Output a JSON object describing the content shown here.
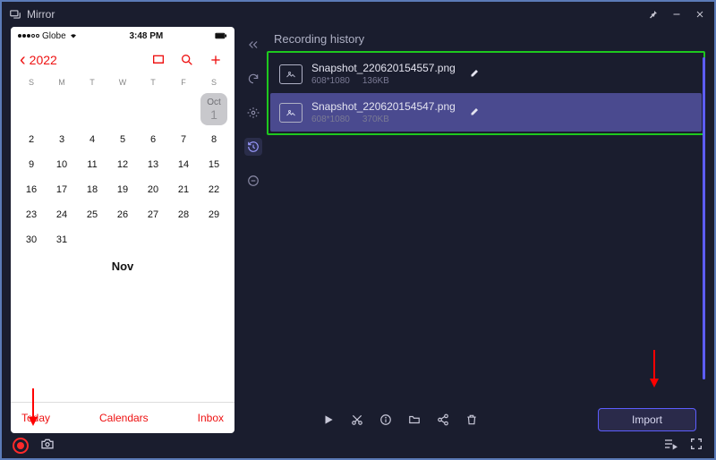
{
  "app": {
    "title": "Mirror"
  },
  "window_controls": [
    "pin",
    "minimize",
    "close"
  ],
  "phone": {
    "status": {
      "carrier": "Globe",
      "signal": "wifi",
      "time": "3:48 PM"
    },
    "calendar": {
      "year_back_label": "2022",
      "dow": [
        "S",
        "M",
        "T",
        "W",
        "T",
        "F",
        "S"
      ],
      "oct_label": "Oct",
      "oct_first": "1",
      "rows": [
        [
          "2",
          "3",
          "4",
          "5",
          "6",
          "7",
          "8"
        ],
        [
          "9",
          "10",
          "11",
          "12",
          "13",
          "14",
          "15"
        ],
        [
          "16",
          "17",
          "18",
          "19",
          "20",
          "21",
          "22"
        ],
        [
          "23",
          "24",
          "25",
          "26",
          "27",
          "28",
          "29"
        ],
        [
          "30",
          "31",
          "",
          "",
          "",
          "",
          ""
        ]
      ],
      "next_month_label": "Nov",
      "footer": {
        "today": "Today",
        "calendars": "Calendars",
        "inbox": "Inbox"
      }
    }
  },
  "right": {
    "section_title": "Recording history",
    "items": [
      {
        "name": "Snapshot_220620154557.png",
        "res": "608*1080",
        "size": "136KB",
        "selected": false
      },
      {
        "name": "Snapshot_220620154547.png",
        "res": "608*1080",
        "size": "370KB",
        "selected": true
      }
    ],
    "toolbar": [
      "play",
      "cut",
      "info",
      "folder",
      "share",
      "delete"
    ],
    "import_label": "Import"
  }
}
